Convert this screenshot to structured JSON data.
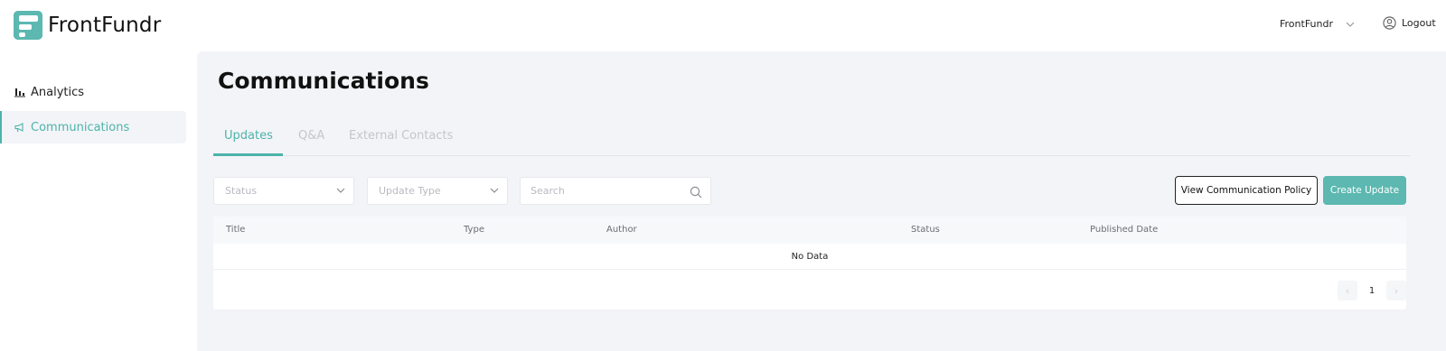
{
  "header": {
    "app_name": "FrontFundr",
    "org_selector": "FrontFundr",
    "logout_label": "Logout"
  },
  "sidebar": {
    "items": [
      {
        "label": "Analytics",
        "icon": "bar-chart-icon",
        "active": false
      },
      {
        "label": "Communications",
        "icon": "megaphone-icon",
        "active": true
      }
    ]
  },
  "main": {
    "title": "Communications",
    "tabs": [
      {
        "label": "Updates",
        "active": true
      },
      {
        "label": "Q&A",
        "active": false
      },
      {
        "label": "External Contacts",
        "active": false
      }
    ],
    "filters": {
      "status_placeholder": "Status",
      "type_placeholder": "Update Type",
      "search_placeholder": "Search"
    },
    "buttons": {
      "policy": "View Communication Policy",
      "create": "Create Update"
    },
    "table": {
      "columns": [
        "Title",
        "Type",
        "Author",
        "Status",
        "Published Date"
      ],
      "empty_text": "No Data"
    },
    "pagination": {
      "current_page": "1",
      "prev": "‹",
      "next": "›"
    }
  },
  "colors": {
    "accent": "#4db3aa",
    "brand_button": "#5cb8b0",
    "main_bg": "#f3f4f8"
  }
}
